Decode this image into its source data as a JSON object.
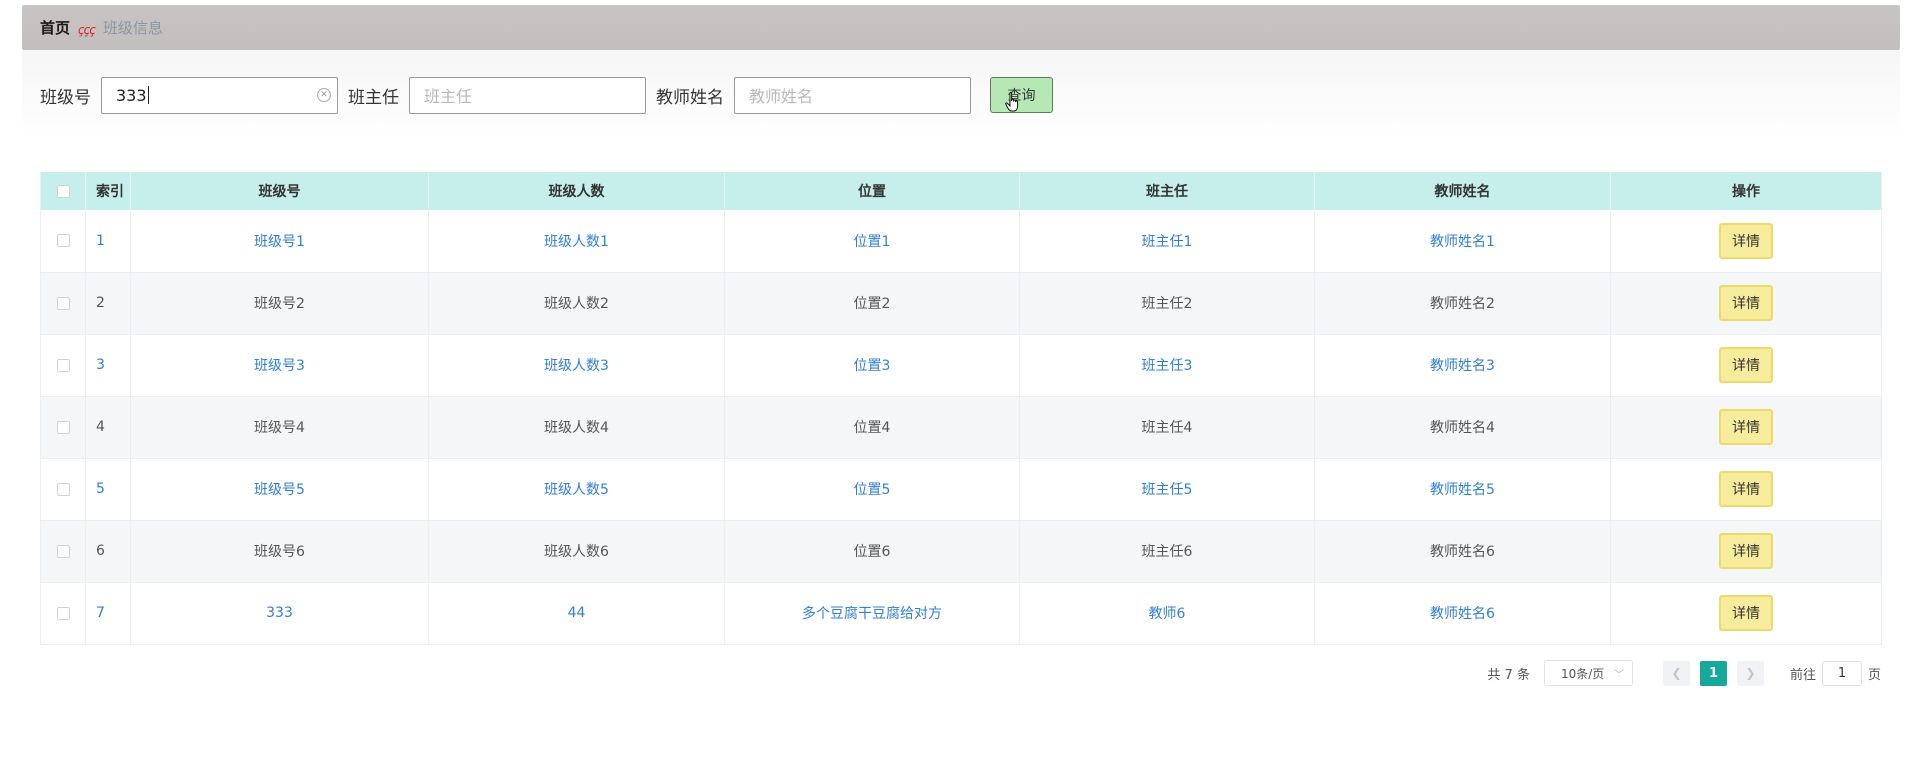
{
  "breadcrumb": {
    "home": "首页",
    "separator": "ççç",
    "current": "班级信息"
  },
  "search": {
    "class_no_label": "班级号",
    "class_no_value": "333",
    "head_teacher_label": "班主任",
    "head_teacher_placeholder": "班主任",
    "teacher_name_label": "教师姓名",
    "teacher_name_placeholder": "教师姓名",
    "query_button": "查询"
  },
  "table": {
    "headers": {
      "index": "索引",
      "class_no": "班级号",
      "class_size": "班级人数",
      "location": "位置",
      "head_teacher": "班主任",
      "teacher_name": "教师姓名",
      "action": "操作"
    },
    "rows": [
      {
        "index": "1",
        "class_no": "班级号1",
        "class_size": "班级人数1",
        "location": "位置1",
        "head_teacher": "班主任1",
        "teacher_name": "教师姓名1",
        "action": "详情"
      },
      {
        "index": "2",
        "class_no": "班级号2",
        "class_size": "班级人数2",
        "location": "位置2",
        "head_teacher": "班主任2",
        "teacher_name": "教师姓名2",
        "action": "详情"
      },
      {
        "index": "3",
        "class_no": "班级号3",
        "class_size": "班级人数3",
        "location": "位置3",
        "head_teacher": "班主任3",
        "teacher_name": "教师姓名3",
        "action": "详情"
      },
      {
        "index": "4",
        "class_no": "班级号4",
        "class_size": "班级人数4",
        "location": "位置4",
        "head_teacher": "班主任4",
        "teacher_name": "教师姓名4",
        "action": "详情"
      },
      {
        "index": "5",
        "class_no": "班级号5",
        "class_size": "班级人数5",
        "location": "位置5",
        "head_teacher": "班主任5",
        "teacher_name": "教师姓名5",
        "action": "详情"
      },
      {
        "index": "6",
        "class_no": "班级号6",
        "class_size": "班级人数6",
        "location": "位置6",
        "head_teacher": "班主任6",
        "teacher_name": "教师姓名6",
        "action": "详情"
      },
      {
        "index": "7",
        "class_no": "333",
        "class_size": "44",
        "location": "多个豆腐干豆腐给对方",
        "head_teacher": "教师6",
        "teacher_name": "教师姓名6",
        "action": "详情"
      }
    ]
  },
  "pagination": {
    "total": "共 7 条",
    "page_size": "10条/页",
    "current_page": "1",
    "goto_label": "前往",
    "goto_value": "1",
    "page_suffix": "页"
  },
  "colors": {
    "accent": "#16a99a",
    "header_bg": "#c6efec",
    "query_button": "#b5e8b5",
    "detail_button": "#f7ec9b",
    "link": "#2f7fd6"
  },
  "icons": {
    "clear": "circle-x-icon",
    "cursor": "hand-pointer-icon",
    "prev": "chevron-left-icon",
    "next": "chevron-right-icon",
    "dropdown": "chevron-down-icon"
  }
}
